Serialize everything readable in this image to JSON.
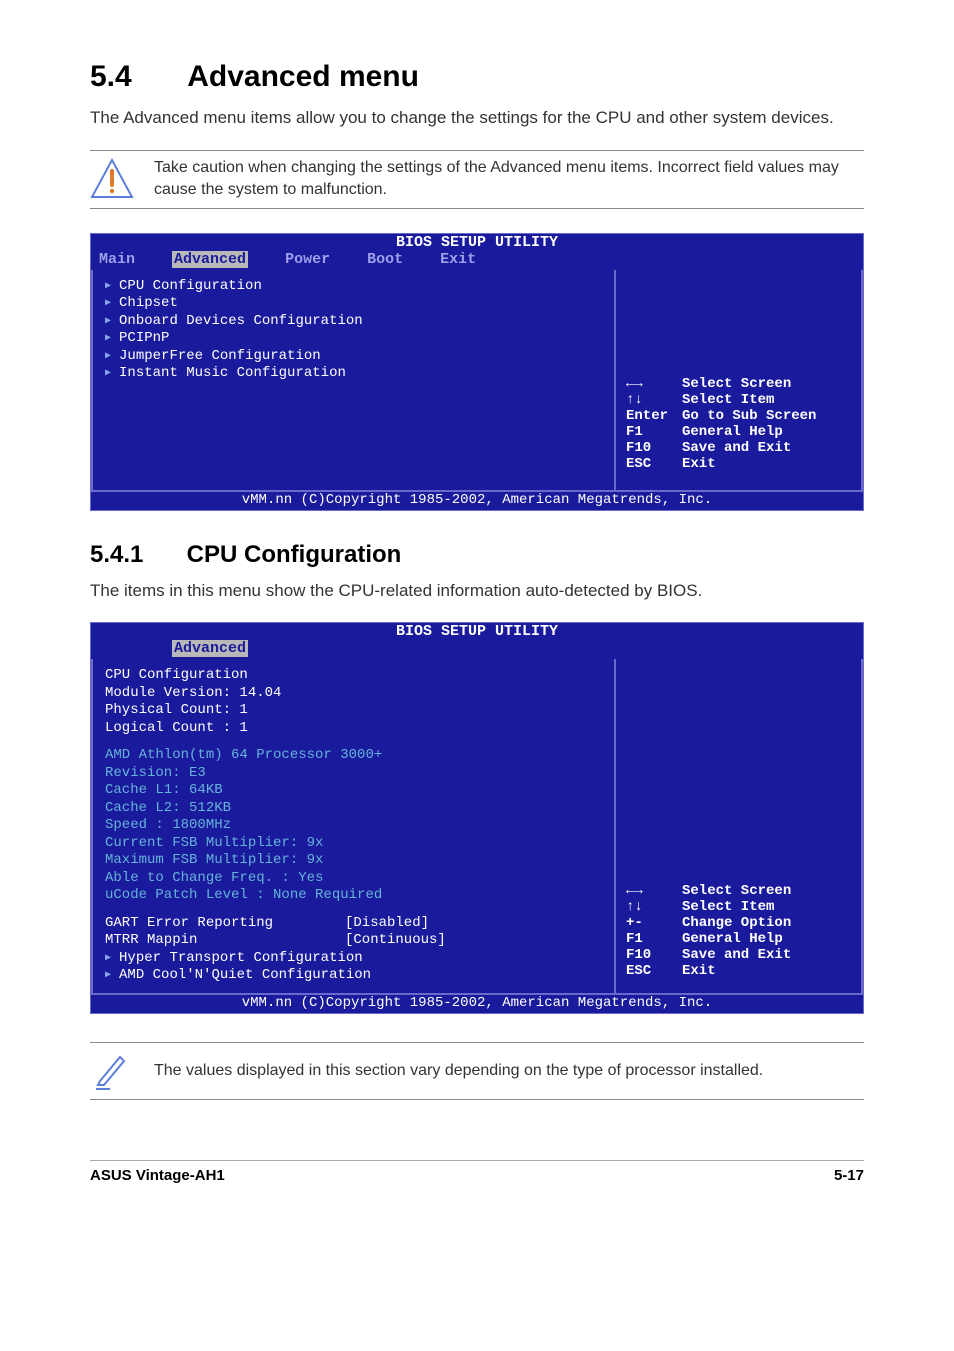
{
  "section": {
    "num": "5.4",
    "title": "Advanced menu",
    "desc": "The Advanced menu items allow you to change the settings for the CPU and other system devices.",
    "caution": "Take caution when changing the settings of the Advanced menu items. Incorrect field values may cause the system to malfunction."
  },
  "bios1": {
    "title": "BIOS SETUP UTILITY",
    "tabs": [
      "Main",
      "Advanced",
      "Power",
      "Boot",
      "Exit"
    ],
    "active_tab": "Advanced",
    "items": [
      "CPU Configuration",
      "Chipset",
      "Onboard Devices Configuration",
      "PCIPnP",
      "JumperFree Configuration",
      "Instant Music Configuration"
    ],
    "help": [
      {
        "k": "←→",
        "t": "Select Screen"
      },
      {
        "k": "↑↓",
        "t": "Select Item"
      },
      {
        "k": "Enter",
        "t": "Go to Sub Screen"
      },
      {
        "k": "F1",
        "t": "General Help"
      },
      {
        "k": "F10",
        "t": "Save and Exit"
      },
      {
        "k": "ESC",
        "t": "Exit"
      }
    ],
    "footer": "vMM.nn (C)Copyright 1985-2002, American Megatrends, Inc."
  },
  "subsection": {
    "num": "5.4.1",
    "title": "CPU Configuration",
    "desc": "The items in this menu show the CPU-related information auto-detected by BIOS."
  },
  "chart_data": {
    "type": "table",
    "title": "CPU Configuration",
    "rows": [
      {
        "label": "Module Version",
        "value": "14.04"
      },
      {
        "label": "Physical Count",
        "value": "1"
      },
      {
        "label": "Logical Count",
        "value": "1"
      },
      {
        "label": "Processor",
        "value": "AMD Athlon(tm) 64 Processor 3000+"
      },
      {
        "label": "Revision",
        "value": "E3"
      },
      {
        "label": "Cache L1",
        "value": "64KB"
      },
      {
        "label": "Cache L2",
        "value": "512KB"
      },
      {
        "label": "Speed",
        "value": "1800MHz"
      },
      {
        "label": "Current FSB Multiplier",
        "value": "9x"
      },
      {
        "label": "Maximum FSB Multiplier",
        "value": "9x"
      },
      {
        "label": "Able to Change Freq.",
        "value": "Yes"
      },
      {
        "label": "uCode Patch Level",
        "value": "None Required"
      },
      {
        "label": "GART Error Reporting",
        "value": "[Disabled]"
      },
      {
        "label": "MTRR Mappin",
        "value": "[Continuous]"
      }
    ]
  },
  "bios2": {
    "title": "BIOS SETUP UTILITY",
    "active_tab": "Advanced",
    "header": "CPU Configuration",
    "hdr_lines": [
      "Module Version: 14.04",
      "Physical Count: 1",
      "Logical Count : 1"
    ],
    "info_lines": [
      "AMD Athlon(tm) 64 Processor 3000+",
      "Revision: E3",
      "Cache L1: 64KB",
      "Cache L2: 512KB",
      "Speed   : 1800MHz",
      "Current FSB Multiplier: 9x",
      "Maximum FSB Multiplier: 9x",
      "Able to Change Freq.  : Yes",
      "uCode Patch Level     : None Required"
    ],
    "options": [
      {
        "lbl": "GART Error Reporting",
        "val": "[Disabled]"
      },
      {
        "lbl": "MTRR Mappin",
        "val": "[Continuous]"
      }
    ],
    "sub_items": [
      "Hyper Transport Configuration",
      "AMD Cool'N'Quiet Configuration"
    ],
    "help": [
      {
        "k": "←→",
        "t": "Select Screen"
      },
      {
        "k": "↑↓",
        "t": "Select Item"
      },
      {
        "k": "+-",
        "t": "Change Option"
      },
      {
        "k": "F1",
        "t": "General Help"
      },
      {
        "k": "F10",
        "t": "Save and Exit"
      },
      {
        "k": "ESC",
        "t": "Exit"
      }
    ],
    "footer": "vMM.nn (C)Copyright 1985-2002, American Megatrends, Inc."
  },
  "note2": "The values displayed in this section vary depending on the type of processor installed.",
  "footer": {
    "left": "ASUS Vintage-AH1",
    "right": "5-17"
  }
}
